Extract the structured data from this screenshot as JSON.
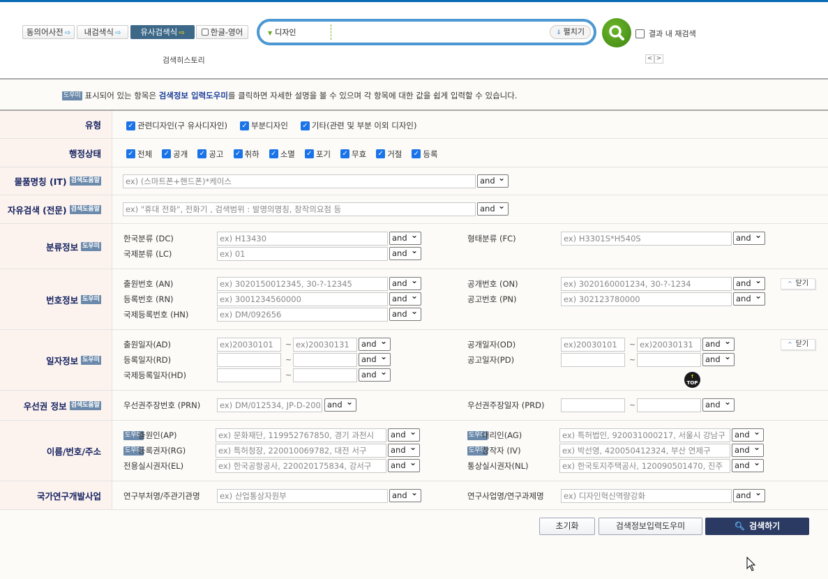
{
  "header": {
    "tool_buttons": [
      {
        "label": "동의어사전",
        "active": false
      },
      {
        "label": "내검색식",
        "active": false
      },
      {
        "label": "유사검색식",
        "active": true
      }
    ],
    "lang_toggle": "한글-영어",
    "search_scope": "디자인",
    "search_value": "",
    "expand_label": "펼치기",
    "search_icon": "magnifier-icon",
    "result_research_label": "결과 내 재검색",
    "result_research_checked": false,
    "history_label": "검색히스토리"
  },
  "notice": {
    "badge": "도우미",
    "text1": " 표시되어 있는 항목은 ",
    "highlight": "검색정보 입력도우미",
    "text2": "를 클릭하면 자세한 설명을 볼 수 있으며 각 항목에 대한 값을 쉽게 입력할 수 있습니다."
  },
  "form": {
    "rows": [
      {
        "label": "유형",
        "type": "checks",
        "items": [
          {
            "label": "관련디자인(구 유사디자인)",
            "checked": true
          },
          {
            "label": "부분디자인",
            "checked": true
          },
          {
            "label": "기타(관련 및 부분 이외 디자인)",
            "checked": true
          }
        ]
      },
      {
        "label": "행정상태",
        "type": "checks",
        "items": [
          {
            "label": "전체",
            "checked": true
          },
          {
            "label": "공개",
            "checked": true
          },
          {
            "label": "공고",
            "checked": true
          },
          {
            "label": "취하",
            "checked": true
          },
          {
            "label": "소멸",
            "checked": true
          },
          {
            "label": "포기",
            "checked": true
          },
          {
            "label": "무효",
            "checked": true
          },
          {
            "label": "거절",
            "checked": true
          },
          {
            "label": "등록",
            "checked": true
          }
        ]
      },
      {
        "label": "물품명칭 (IT)",
        "help": "검색도움말",
        "type": "text",
        "placeholder": "ex) (스마트폰+핸드폰)*케이스",
        "op": "and"
      },
      {
        "label": "자유검색 (전문)",
        "help": "검색도움말",
        "type": "text",
        "placeholder": "ex) \"휴대 전화\", 전화기 , 검색범위 : 발명의명칭, 창작의요점 등",
        "op": "and"
      },
      {
        "label": "분류정보",
        "help": "도우미",
        "type": "fields",
        "left": [
          {
            "label": "한국분류 (DC)",
            "placeholder": "ex) H13430",
            "op": "and"
          },
          {
            "label": "국제분류 (LC)",
            "placeholder": "ex) 01",
            "op": "and"
          }
        ],
        "right": [
          {
            "label": "형태분류 (FC)",
            "placeholder": "ex) H3301S*H540S",
            "op": "and"
          }
        ]
      },
      {
        "label": "번호정보",
        "help": "도우미",
        "type": "fields",
        "close": "닫기",
        "left": [
          {
            "label": "출원번호 (AN)",
            "placeholder": "ex) 3020150012345, 30-?-12345",
            "op": "and"
          },
          {
            "label": "등록번호 (RN)",
            "placeholder": "ex) 3001234560000",
            "op": "and"
          },
          {
            "label": "국제등록번호 (HN)",
            "placeholder": "ex) DM/092656",
            "op": "and"
          }
        ],
        "right": [
          {
            "label": "공개번호 (ON)",
            "placeholder": "ex) 3020160001234, 30-?-1234",
            "op": "and"
          },
          {
            "label": "공고번호 (PN)",
            "placeholder": "ex) 302123780000",
            "op": "and"
          }
        ]
      },
      {
        "label": "일자정보",
        "help": "도우미",
        "type": "fields",
        "close": "닫기",
        "left": [
          {
            "label": "출원일자(AD)",
            "date": true,
            "from": "ex)20030101",
            "to": "ex)20030131",
            "op": "and"
          },
          {
            "label": "등록일자(RD)",
            "date": true,
            "from": "",
            "to": "",
            "op": "and"
          },
          {
            "label": "국제등록일자(HD)",
            "date": true,
            "from": "",
            "to": "",
            "op": "and"
          }
        ],
        "right": [
          {
            "label": "공개일자(OD)",
            "date": true,
            "from": "ex)20030101",
            "to": "ex)20030131",
            "op": "and"
          },
          {
            "label": "공고일자(PD)",
            "date": true,
            "from": "",
            "to": "",
            "op": "and"
          }
        ]
      },
      {
        "label": "우선권 정보",
        "help": "검색도움말",
        "type": "fields",
        "left": [
          {
            "label": "우선권주장번호 (PRN)",
            "placeholder": "ex) DM/012534, JP-D-2003",
            "op": "and",
            "short": true
          }
        ],
        "right": [
          {
            "label": "우선권주장일자 (PRD)",
            "date": true,
            "from": "",
            "to": "",
            "op": "and"
          }
        ]
      },
      {
        "label": "이름/번호/주소",
        "type": "fields",
        "names": true,
        "left": [
          {
            "label": "출원인(AP)",
            "help": "도우미",
            "placeholder": "ex) 문화재단, 119952767850, 경기 과천시",
            "op": "and"
          },
          {
            "label": "등록권자(RG)",
            "help": "도우미",
            "placeholder": "ex) 특허청장, 220010069782, 대전 서구",
            "op": "and"
          },
          {
            "label": "전용실시권자(EL)",
            "placeholder": "ex) 한국공항공사, 220020175834, 강서구",
            "op": "and"
          }
        ],
        "right": [
          {
            "label": "대리인(AG)",
            "help": "도우미",
            "placeholder": "ex) 특허법인, 920031000217, 서울시 강남구",
            "op": "and"
          },
          {
            "label": "창작자 (IV)",
            "help": "도우미",
            "placeholder": "ex) 박선영, 420050412324, 부산 연제구",
            "op": "and"
          },
          {
            "label": "통상실시권자(NL)",
            "placeholder": "ex) 한국토지주택공사, 120090501470, 진주",
            "op": "and"
          }
        ]
      },
      {
        "label": "국가연구개발사업",
        "type": "fields",
        "left": [
          {
            "label": "연구부처명/주관기관명",
            "placeholder": "ex) 산업통상자원부",
            "op": "and"
          }
        ],
        "right": [
          {
            "label": "연구사업명/연구과제명",
            "placeholder": "ex) 디자인혁신역량강화",
            "op": "and"
          }
        ]
      }
    ]
  },
  "top_button": "TOP",
  "footer": {
    "reset": "초기화",
    "helper": "검색정보입력도우미",
    "search": "검색하기"
  },
  "colors": {
    "accent": "#0a6ab4",
    "search_button": "#2b3a63",
    "go_button": "#4f9a1c",
    "label_bg": "#fcf3ef",
    "label_text": "#13205e"
  }
}
